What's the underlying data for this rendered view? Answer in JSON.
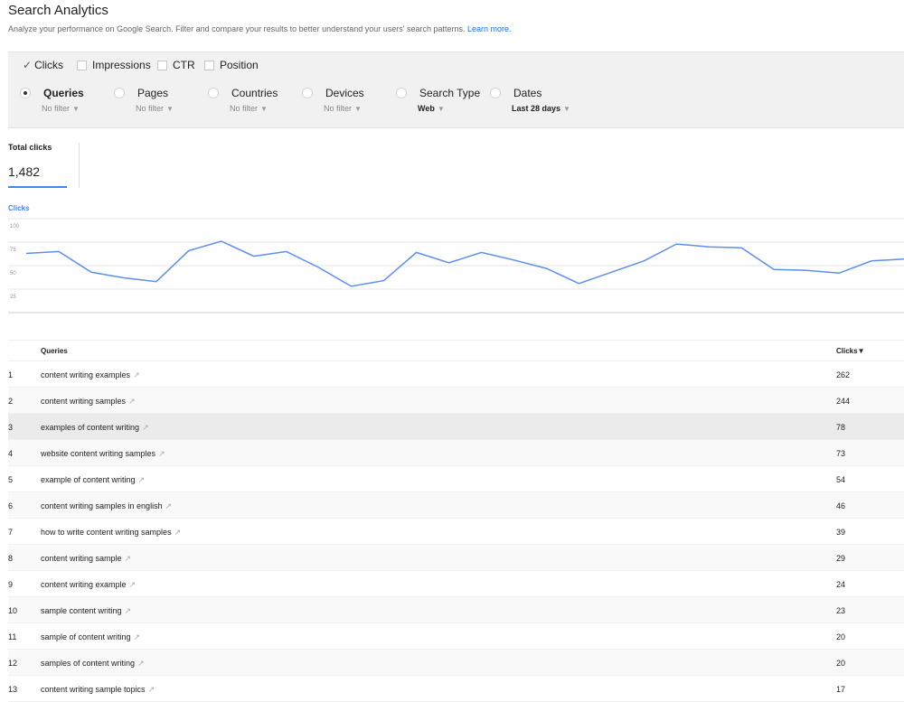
{
  "header": {
    "title": "Search Analytics",
    "subtitle": "Analyze your performance on Google Search. Filter and compare your results to better understand your users' search patterns.",
    "learn_more": "Learn more."
  },
  "metrics": [
    {
      "label": "Clicks",
      "checked": true
    },
    {
      "label": "Impressions",
      "checked": false
    },
    {
      "label": "CTR",
      "checked": false
    },
    {
      "label": "Position",
      "checked": false
    }
  ],
  "dimensions": [
    {
      "label": "Queries",
      "value": "No filter",
      "selected": true
    },
    {
      "label": "Pages",
      "value": "No filter",
      "selected": false
    },
    {
      "label": "Countries",
      "value": "No filter",
      "selected": false
    },
    {
      "label": "Devices",
      "value": "No filter",
      "selected": false
    },
    {
      "label": "Search Type",
      "value": "Web",
      "selected": false
    },
    {
      "label": "Dates",
      "value": "Last 28 days",
      "selected": false
    }
  ],
  "totals": {
    "label": "Total clicks",
    "value": "1,482"
  },
  "chart_data": {
    "type": "line",
    "legend": [
      "Clicks"
    ],
    "y_ticks": [
      100,
      75,
      50,
      25
    ],
    "ylim": [
      0,
      100
    ],
    "grid": true,
    "color": "#5b8ff0",
    "series": [
      {
        "name": "Clicks",
        "values": [
          63,
          65,
          43,
          37,
          33,
          66,
          76,
          60,
          65,
          48,
          28,
          34,
          64,
          53,
          64,
          56,
          47,
          31,
          43,
          55,
          73,
          70,
          69,
          46,
          45,
          42,
          55,
          57
        ]
      }
    ]
  },
  "table": {
    "columns": [
      "Queries",
      "Clicks▼"
    ],
    "rows": [
      {
        "rank": "1",
        "query": "content writing examples",
        "clicks": "262"
      },
      {
        "rank": "2",
        "query": "content writing samples",
        "clicks": "244"
      },
      {
        "rank": "3",
        "query": "examples of content writing",
        "clicks": "78"
      },
      {
        "rank": "4",
        "query": "website content writing samples",
        "clicks": "73"
      },
      {
        "rank": "5",
        "query": "example of content writing",
        "clicks": "54"
      },
      {
        "rank": "6",
        "query": "content writing samples in english",
        "clicks": "46"
      },
      {
        "rank": "7",
        "query": "how to write content writing samples",
        "clicks": "39"
      },
      {
        "rank": "8",
        "query": "content writing sample",
        "clicks": "29"
      },
      {
        "rank": "9",
        "query": "content writing example",
        "clicks": "24"
      },
      {
        "rank": "10",
        "query": "sample content writing",
        "clicks": "23"
      },
      {
        "rank": "11",
        "query": "sample of content writing",
        "clicks": "20"
      },
      {
        "rank": "12",
        "query": "samples of content writing",
        "clicks": "20"
      },
      {
        "rank": "13",
        "query": "content writing sample topics",
        "clicks": "17"
      }
    ]
  },
  "icons": {
    "check": "check-icon",
    "external": "external-link-icon",
    "caret": "caret-down-icon"
  }
}
